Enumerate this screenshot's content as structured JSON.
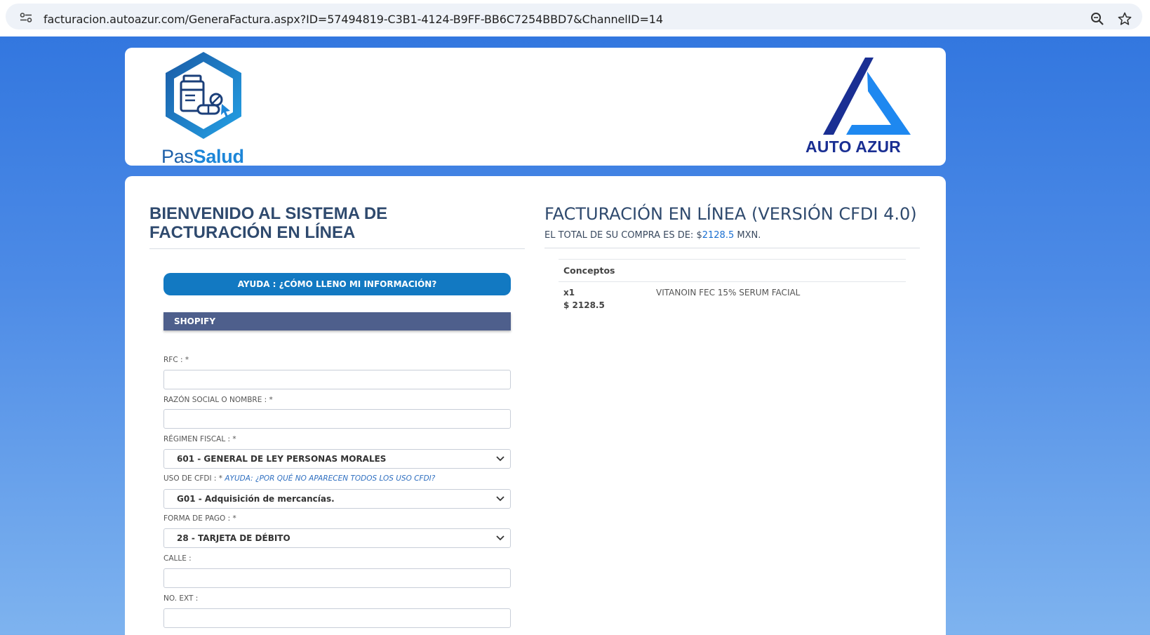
{
  "browser": {
    "url": "facturacion.autoazur.com/GeneraFactura.aspx?ID=57494819-C3B1-4124-B9FF-BB6C7254BBD7&ChannelID=14",
    "icons": [
      "site-info-icon",
      "zoom-icon",
      "star-icon"
    ]
  },
  "header": {
    "left_logo": {
      "part1": "Pas",
      "part2": "Salud"
    },
    "right_logo": {
      "text": "AUTO AZUR"
    },
    "colors": {
      "passalud_dark": "#1d5fa8",
      "passalud_light": "#1d86d8",
      "autoazur_navy": "#1a2f93",
      "autoazur_blue": "#1e88f0"
    }
  },
  "left": {
    "title": "BIENVENIDO AL SISTEMA DE FACTURACIÓN EN LÍNEA",
    "help_button": "AYUDA : ¿CÓMO LLENO MI INFORMACIÓN?",
    "section": "SHOPIFY",
    "fields": {
      "rfc": {
        "label": "RFC : *",
        "value": ""
      },
      "razon": {
        "label": "RAZÓN SOCIAL O NOMBRE : *",
        "value": ""
      },
      "regimen": {
        "label": "RÉGIMEN FISCAL : *",
        "value": "601 - GENERAL DE LEY PERSONAS MORALES"
      },
      "uso": {
        "label": "USO DE CFDI : *",
        "help": "AYUDA: ¿POR QUÉ NO APARECEN TODOS LOS USO CFDI?",
        "value": "G01 - Adquisición de mercancías."
      },
      "pago": {
        "label": "FORMA DE PAGO : *",
        "value": "28 - TARJETA DE DÉBITO"
      },
      "calle": {
        "label": "CALLE :",
        "value": ""
      },
      "noext": {
        "label": "NO. EXT :",
        "value": ""
      }
    }
  },
  "right": {
    "title": "FACTURACIÓN EN LÍNEA (VERSIÓN CFDI 4.0)",
    "total_prefix": "EL TOTAL DE SU COMPRA ES DE: $",
    "total_amount": "2128.5",
    "total_suffix": " MXN.",
    "concepts_header": "Conceptos",
    "items": [
      {
        "qty": "x1",
        "price": "$ 2128.5",
        "description": "VITANOIN FEC 15% SERUM FACIAL"
      }
    ]
  }
}
